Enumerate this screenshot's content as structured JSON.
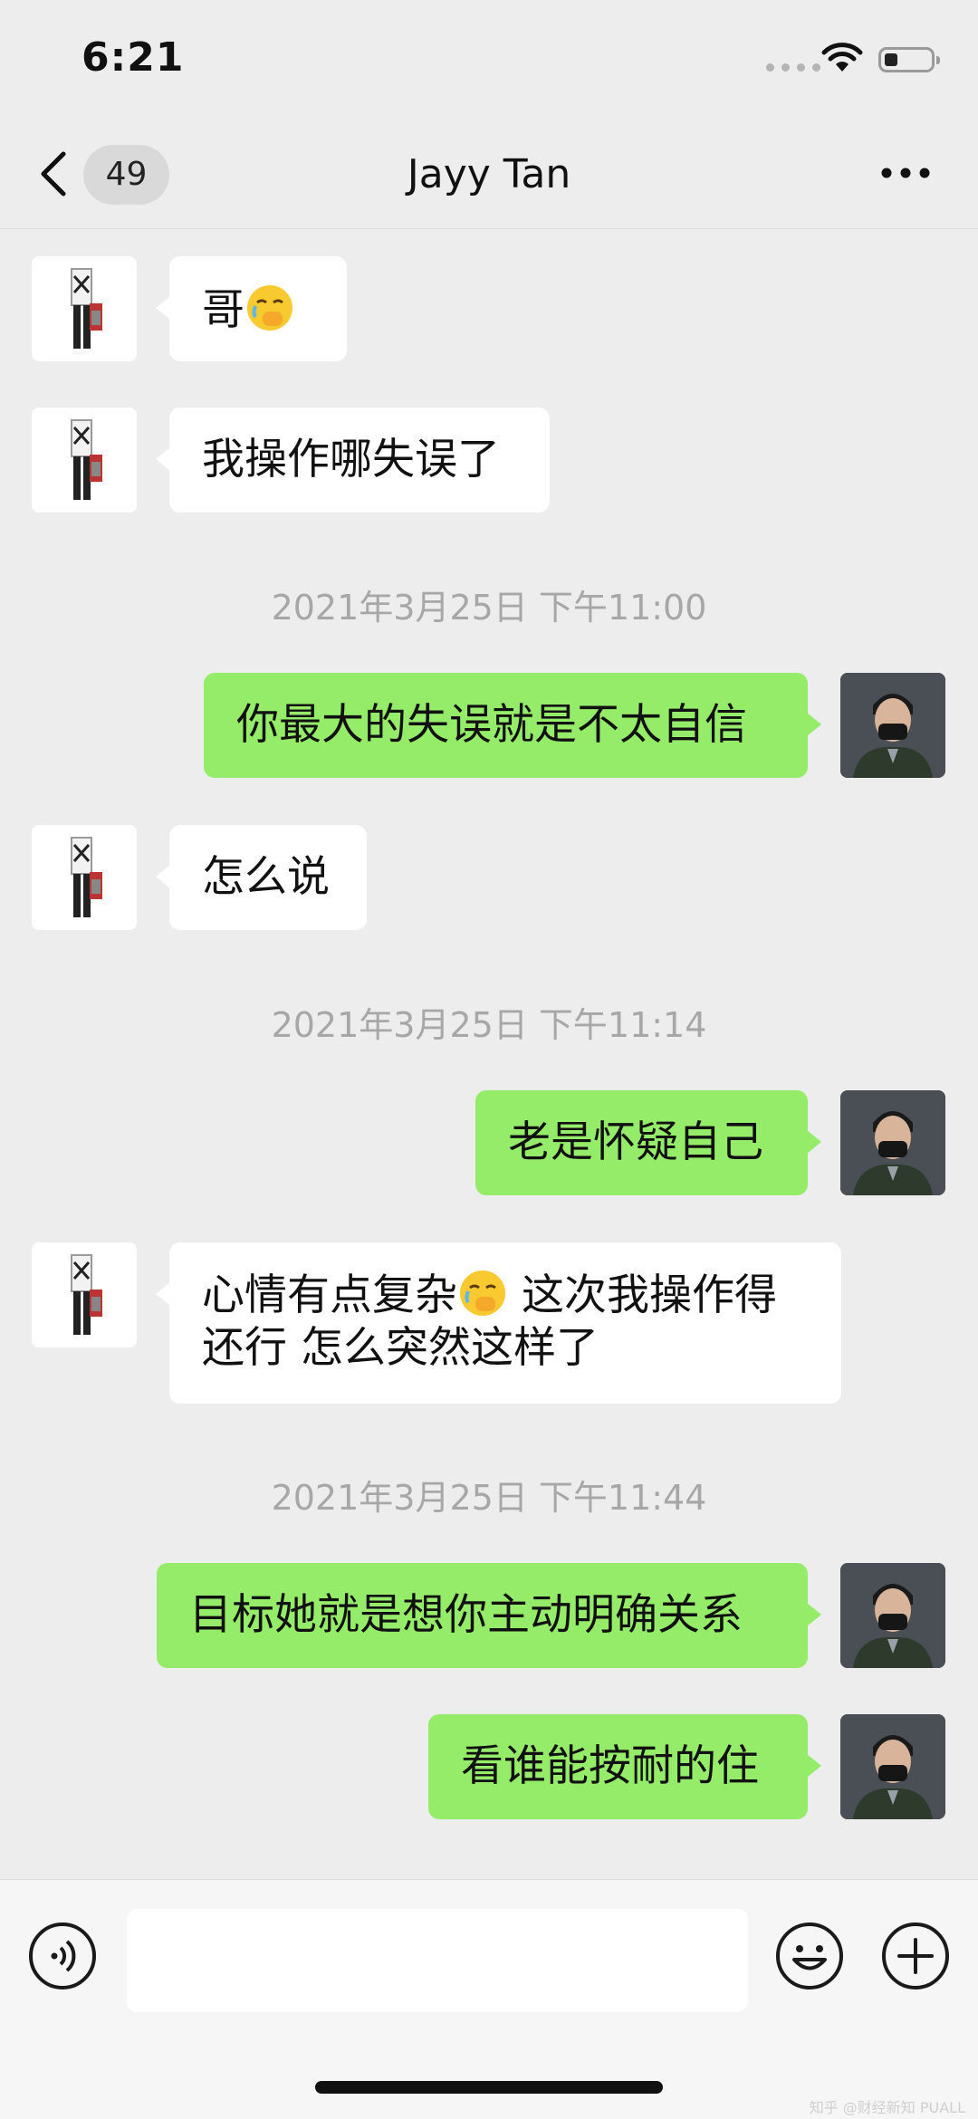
{
  "status_bar": {
    "time": "6:21"
  },
  "nav": {
    "unread_count": "49",
    "title": "Jayy Tan"
  },
  "messages": [
    {
      "side": "in",
      "text": "哥",
      "emoji": "face-with-hand-over-mouth"
    },
    {
      "side": "in",
      "text": "我操作哪失误了"
    },
    {
      "side": "time",
      "text": "2021年3月25日 下午11:00"
    },
    {
      "side": "out",
      "text": "你最大的失误就是不太自信"
    },
    {
      "side": "in",
      "text": "怎么说"
    },
    {
      "side": "time",
      "text": "2021年3月25日 下午11:14"
    },
    {
      "side": "out",
      "text": "老是怀疑自己"
    },
    {
      "side": "in",
      "text_a": "心情有点复杂",
      "emoji": "face-with-hand-over-mouth",
      "text_b": " 这次我操作得",
      "text_c": "还行 怎么突然这样了"
    },
    {
      "side": "time",
      "text": "2021年3月25日 下午11:44"
    },
    {
      "side": "out",
      "text": "目标她就是想你主动明确关系"
    },
    {
      "side": "out",
      "text": "看谁能按耐的住"
    }
  ],
  "input": {
    "value": "",
    "placeholder": ""
  },
  "icons": {
    "back": "chevron-left-icon",
    "more": "more-dots-icon",
    "voice": "voice-icon",
    "emoji": "emoji-icon",
    "plus": "plus-icon"
  },
  "watermark": "知乎 @财经新知 PUALL",
  "colors": {
    "background": "#ededed",
    "bubble_out": "#95ec69",
    "bubble_in": "#ffffff",
    "timestamp": "#a7a7a7"
  }
}
